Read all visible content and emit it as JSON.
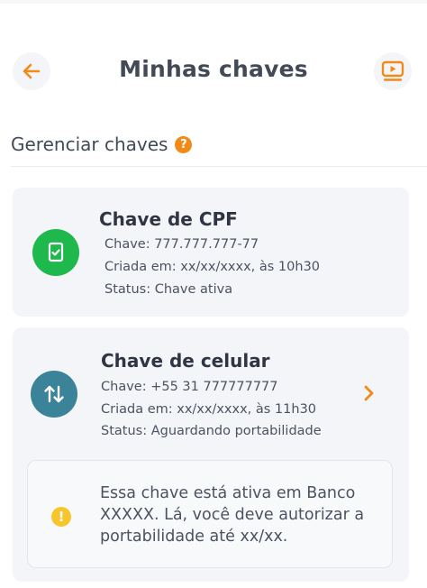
{
  "header": {
    "title": "Minhas chaves"
  },
  "section": {
    "title": "Gerenciar chaves",
    "help_symbol": "?"
  },
  "keys": [
    {
      "title": "Chave de CPF",
      "line1": "Chave: 777.777.777-77",
      "line2": "Criada em: xx/xx/xxxx, às 10h30",
      "line3": "Status: Chave ativa",
      "icon": "document-check-icon",
      "icon_color": "#1fb84c"
    },
    {
      "title": "Chave de celular",
      "line1": "Chave: +55 31 777777777",
      "line2": "Criada em: xx/xx/xxxx, às 11h30",
      "line3": "Status: Aguardando portabilidade",
      "icon": "transfer-arrows-icon",
      "icon_color": "#3b8399",
      "notice": {
        "text": "Essa chave está ativa em Banco XXXXX. Lá, você deve autorizar a portabilidade até xx/xx.",
        "symbol": "!"
      }
    }
  ],
  "colors": {
    "accent": "#f08a18",
    "card_bg": "#f4f5f8",
    "warning": "#f7c52b"
  }
}
